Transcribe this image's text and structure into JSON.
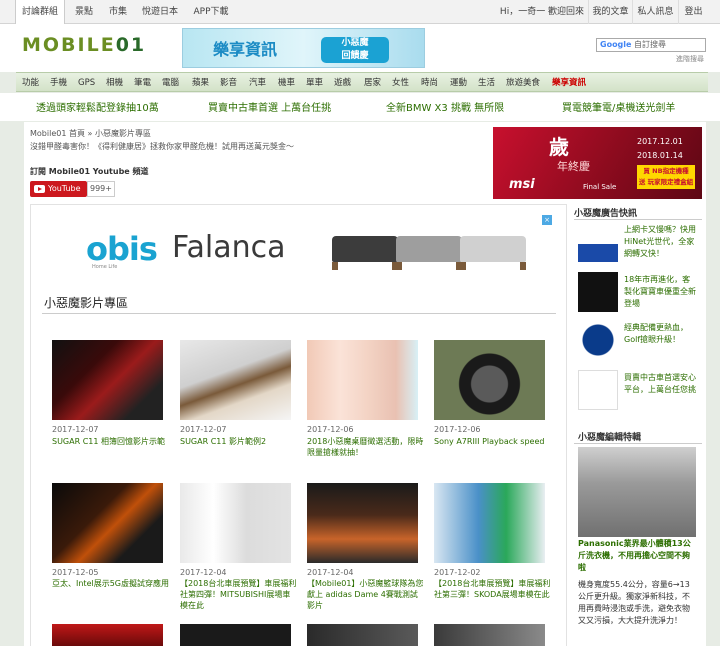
{
  "topbar": {
    "tabs": [
      "討論群組",
      "景點",
      "市集",
      "悅遊日本",
      "APP下載"
    ],
    "greeting": "Hi，一奇一  歡迎回來 ▼",
    "links": [
      "我的文章",
      "私人訊息",
      "登出"
    ]
  },
  "header": {
    "logo_main": "MOBILE",
    "logo_num": "01",
    "banner_text": "樂享資訊",
    "banner_badge": "小惡魔\n回饋慶",
    "search_brand": "Google",
    "search_placeholder": "自訂搜尋",
    "advanced_search": "進階搜尋"
  },
  "catnav": [
    "功能",
    "手機",
    "GPS",
    "相機",
    "筆電",
    "電腦",
    "蘋果",
    "影音",
    "汽車",
    "機車",
    "單車",
    "遊戲",
    "居家",
    "女性",
    "時尚",
    "運動",
    "生活",
    "旅遊美食",
    "樂享資訊"
  ],
  "promos": [
    "透過頭家輕鬆配登錄抽10萬",
    "買賣中古車首選 上萬台任挑",
    "全新BMW X3 挑戰 無所限",
    "買電競筆電/桌機送光劍羊"
  ],
  "breadcrumb": "Mobile01 首頁 » 小惡魔影片專區",
  "subtitle": "沒錯甲醛毒害你！《得利健康居》拯救你家甲醛危機！試用再送萬元獎金～",
  "youtube": {
    "subscribe_title": "訂閱 Mobile01 Youtube 頻道",
    "button_label": "YouTube",
    "count": "999+"
  },
  "msi_ad": {
    "big": "歲",
    "small": "年終慶",
    "date1": "2017.12.01",
    "date2": "2018.01.14",
    "tag": "買 NB指定機種\n送 玩家限定禮盒組",
    "logo": "msi",
    "final": "Final Sale"
  },
  "obis_ad": {
    "brand1": "obis",
    "brand1_sub": "Home Life",
    "brand2": "Falanca",
    "close": "×"
  },
  "section_title": "小惡魔影片專區",
  "videos": [
    {
      "date": "2017-12-07",
      "title": "SUGAR C11 相簿回憶影片示範"
    },
    {
      "date": "2017-12-07",
      "title": "SUGAR C11 影片範例2"
    },
    {
      "date": "2017-12-06",
      "title": "2018小惡魔桌曆徵選活動，限時限量搶樣就抽！"
    },
    {
      "date": "2017-12-06",
      "title": "Sony A7RIII Playback speed"
    },
    {
      "date": "2017-12-05",
      "title": "亞太、Intel展示5G虛擬試穿應用"
    },
    {
      "date": "2017-12-04",
      "title": "【2018台北車展預覽】車展福利社第四彈！MITSUBISHI展場車模在此"
    },
    {
      "date": "2017-12-04",
      "title": "【Mobile01】小惡魔籃球隊為您獻上 adidas Dame 4賽戰測試影片"
    },
    {
      "date": "2017-12-02",
      "title": "【2018台北車展預覽】車展福利社第三彈！SKODA展場車模在此"
    }
  ],
  "right": {
    "ads_title": "小惡魔廣告快訊",
    "ads": [
      {
        "text": "上網卡又慢嗎？快用HiNet光世代，全家網轉又快！",
        "img": "HiNet 光世代"
      },
      {
        "text": "18年市再進化，客製化寶寶車優重全新登場",
        "img": "TIIDA 18年"
      },
      {
        "text": "經典配備更熱血，Golf搶眼升級！",
        "img": "Volkswagen"
      },
      {
        "text": "買賣中古車首選安心平台，上萬台任您挑",
        "img": "abc好車網"
      }
    ],
    "feature_title": "小惡魔編輯特輯",
    "product_title": "Panasonic業界最小體積13公斤洗衣機，不用再擔心空間不夠啦",
    "product_desc": "機身寬度55.4公分，容量6→13公斤更升級。獨家淨新科技，不用再費時浸泡或手洗，避免衣物又又污損，大大提升洗淨力！"
  }
}
